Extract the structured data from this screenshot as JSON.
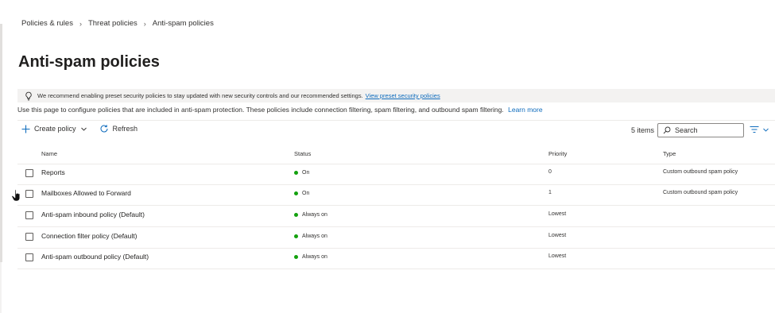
{
  "breadcrumb": {
    "items": [
      "Policies & rules",
      "Threat policies",
      "Anti-spam policies"
    ]
  },
  "page": {
    "title": "Anti-spam policies"
  },
  "banner": {
    "text": "We recommend enabling preset security policies to stay updated with new security controls and our recommended settings.",
    "link": "View preset security policies"
  },
  "description": {
    "text": "Use this page to configure policies that are included in anti-spam protection. These policies include connection filtering, spam filtering, and outbound spam filtering.",
    "link": "Learn more"
  },
  "toolbar": {
    "create_label": "Create policy",
    "refresh_label": "Refresh",
    "items_count": "5 items",
    "search_placeholder": "Search"
  },
  "table": {
    "columns": [
      "Name",
      "Status",
      "Priority",
      "Type"
    ],
    "rows": [
      {
        "name": "Reports",
        "status": "On",
        "priority": "0",
        "type": "Custom outbound spam policy"
      },
      {
        "name": "Mailboxes Allowed to Forward",
        "status": "On",
        "priority": "1",
        "type": "Custom outbound spam policy"
      },
      {
        "name": "Anti-spam inbound policy (Default)",
        "status": "Always on",
        "priority": "Lowest",
        "type": ""
      },
      {
        "name": "Connection filter policy (Default)",
        "status": "Always on",
        "priority": "Lowest",
        "type": ""
      },
      {
        "name": "Anti-spam outbound policy (Default)",
        "status": "Always on",
        "priority": "Lowest",
        "type": ""
      }
    ]
  },
  "colors": {
    "link": "#0f6cbd",
    "status_on": "#13a10e",
    "banner_bg": "#f3f2f1"
  },
  "icons": [
    "lightbulb-icon",
    "plus-icon",
    "chevron-down-icon",
    "refresh-icon",
    "search-icon",
    "filter-icon",
    "chevron-right-icon"
  ]
}
